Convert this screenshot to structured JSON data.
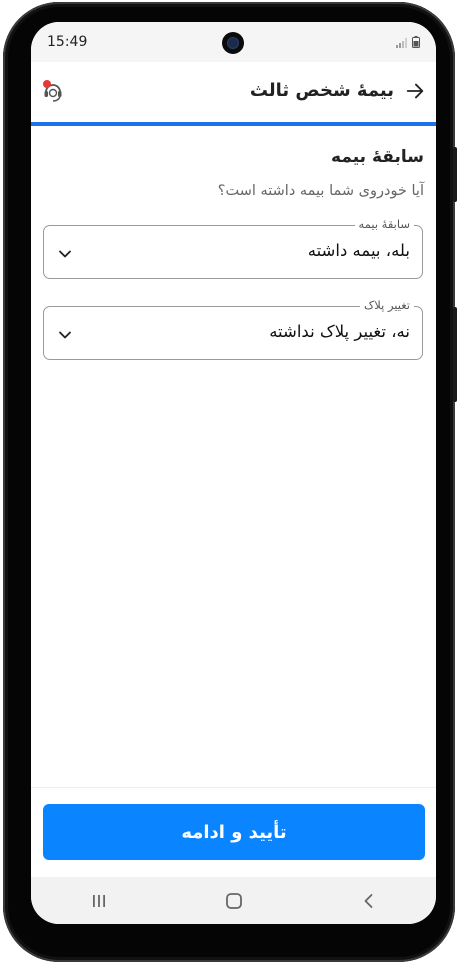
{
  "status_bar": {
    "time": "15:49"
  },
  "header": {
    "title": "بیمهٔ شخص ثالث"
  },
  "section": {
    "title": "سابقهٔ بیمه",
    "question": "آیا خودروی شما بیمه داشته است؟"
  },
  "fields": [
    {
      "label": "سابقهٔ بیمه",
      "value": "بله، بیمه داشته"
    },
    {
      "label": "تغییر پلاک",
      "value": "نه، تغییر پلاک نداشته"
    }
  ],
  "cta": {
    "label": "تأیید و ادامه"
  },
  "colors": {
    "accent": "#1a73e8",
    "button": "#0a84ff",
    "badge": "#e53935"
  },
  "icons": [
    "back-arrow-icon",
    "support-icon",
    "chevron-down-icon",
    "recents-icon",
    "home-icon",
    "nav-back-icon"
  ]
}
